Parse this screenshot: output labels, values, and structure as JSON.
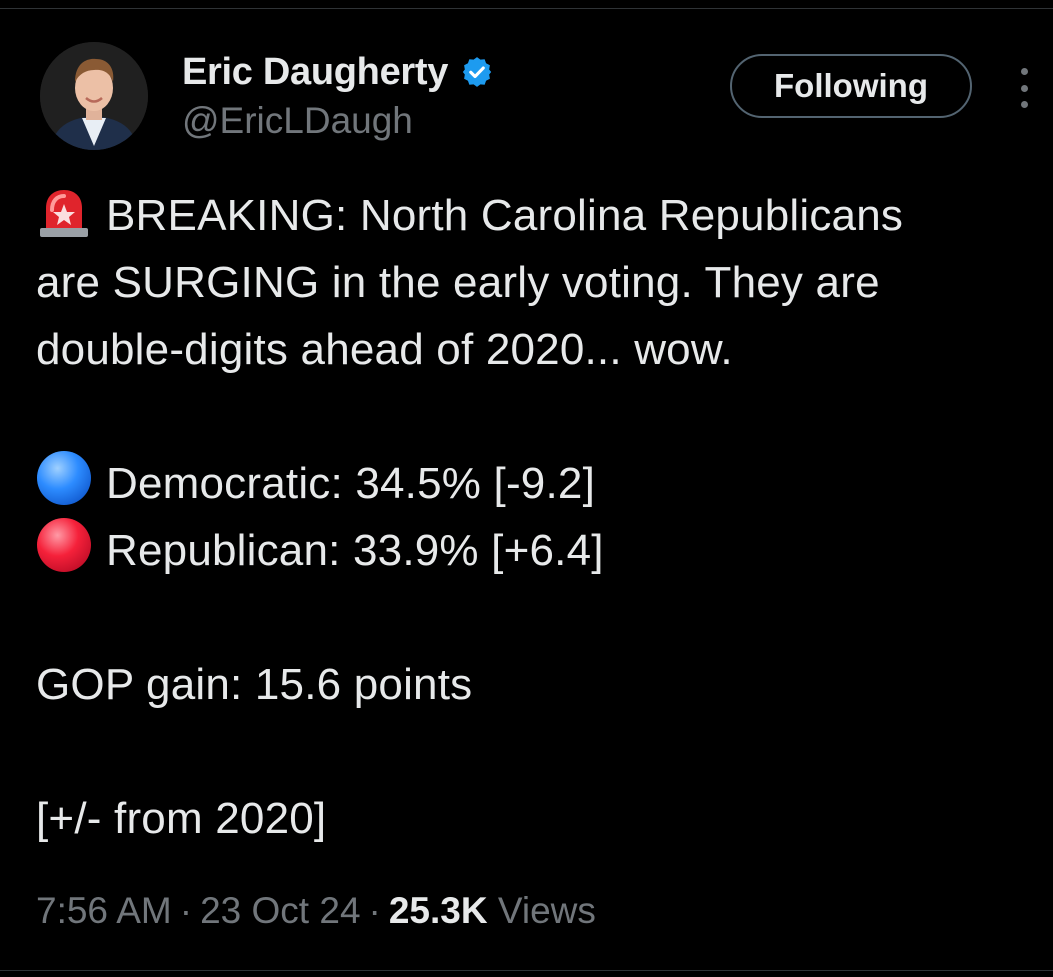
{
  "author": {
    "display_name": "Eric Daugherty",
    "handle": "@EricLDaugh",
    "verified": true,
    "verified_color": "#1d9bf0"
  },
  "actions": {
    "follow_label": "Following",
    "more_icon": "more-vertical-icon"
  },
  "tweet": {
    "line1": "BREAKING: North Carolina Republicans",
    "line2": "are SURGING in the early voting. They are",
    "line3": "double-digits ahead of 2020... wow.",
    "dem_line": "Democratic: 34.5% [-9.2]",
    "rep_line": "Republican: 33.9% [+6.4]",
    "gain_line": "GOP gain: 15.6 points",
    "note_line": "[+/- from 2020]",
    "icons": {
      "siren": "rotating-light-icon",
      "dem": "blue-circle-icon",
      "rep": "red-circle-icon"
    }
  },
  "meta": {
    "time": "7:56 AM",
    "date": "23 Oct 24",
    "views_count": "25.3K",
    "views_label": "Views",
    "separator": "·"
  },
  "colors": {
    "background": "#000000",
    "text": "#e7e9ea",
    "secondary": "#71767b",
    "accent": "#1d9bf0"
  }
}
